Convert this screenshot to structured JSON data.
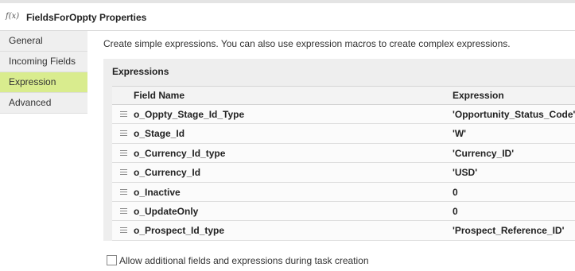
{
  "header": {
    "fx_label": "f(x)",
    "title": "FieldsForOppty Properties"
  },
  "sidebar": {
    "items": [
      {
        "label": "General"
      },
      {
        "label": "Incoming Fields"
      },
      {
        "label": "Expression"
      },
      {
        "label": "Advanced"
      }
    ],
    "active": "Expression"
  },
  "main": {
    "description": "Create simple expressions. You can also use expression macros to create complex expressions.",
    "expressions": {
      "title": "Expressions",
      "columns": {
        "field_name": "Field Name",
        "expression": "Expression"
      },
      "rows": [
        {
          "field": "o_Oppty_Stage_Id_Type",
          "expr": "'Opportunity_Status_Code'"
        },
        {
          "field": "o_Stage_Id",
          "expr": "'W'"
        },
        {
          "field": "o_Currency_Id_type",
          "expr": "'Currency_ID'"
        },
        {
          "field": "o_Currency_Id",
          "expr": "'USD'"
        },
        {
          "field": "o_Inactive",
          "expr": "0"
        },
        {
          "field": "o_UpdateOnly",
          "expr": "0"
        },
        {
          "field": "o_Prospect_Id_type",
          "expr": "'Prospect_Reference_ID'"
        }
      ]
    },
    "allow_checkbox": {
      "label": "Allow additional fields and expressions during task creation",
      "checked": false
    }
  },
  "colors": {
    "active_nav": "#d9ec8e",
    "panel_bg": "#eeeeee"
  }
}
